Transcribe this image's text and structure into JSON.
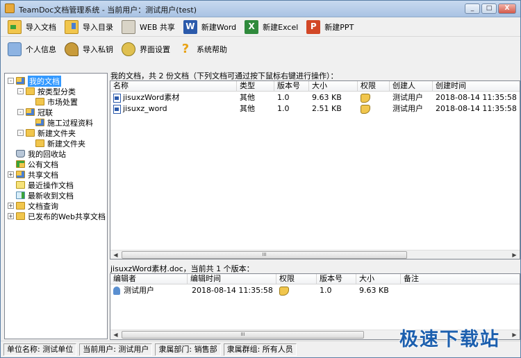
{
  "window": {
    "title": "TeamDoc文档管理系统 - 当前用户：测试用户(test)",
    "buttons": [
      "_",
      "□",
      "X"
    ]
  },
  "toolbar_main": [
    {
      "label": "导入文档",
      "icon": "import-document-icon"
    },
    {
      "label": "导入目录",
      "icon": "import-folder-icon"
    },
    {
      "label": "WEB 共享",
      "icon": "web-share-icon"
    },
    {
      "label": "新建Word",
      "icon": "word-icon",
      "glyph": "W"
    },
    {
      "label": "新建Excel",
      "icon": "excel-icon",
      "glyph": "X"
    },
    {
      "label": "新建PPT",
      "icon": "ppt-icon",
      "glyph": "P"
    }
  ],
  "toolbar_settings": [
    {
      "label": "个人信息",
      "icon": "user-info-icon"
    },
    {
      "label": "导入私钥",
      "icon": "key-icon"
    },
    {
      "label": "界面设置",
      "icon": "gear-icon"
    },
    {
      "label": "系统帮助",
      "icon": "help-icon",
      "glyph": "?"
    }
  ],
  "tree": {
    "nodes": [
      {
        "label": "我的文档",
        "level": 0,
        "expander": "-",
        "icon": "t-folder-share",
        "selected": true
      },
      {
        "label": "按类型分类",
        "level": 1,
        "expander": "-",
        "icon": "t-folder"
      },
      {
        "label": "市场处置",
        "level": 2,
        "expander": "",
        "icon": "t-folder"
      },
      {
        "label": "冠联",
        "level": 1,
        "expander": "-",
        "icon": "t-folder-share"
      },
      {
        "label": "施工过程资料",
        "level": 2,
        "expander": "",
        "icon": "t-folder-share"
      },
      {
        "label": "新建文件夹",
        "level": 1,
        "expander": "-",
        "icon": "t-folder"
      },
      {
        "label": "新建文件夹",
        "level": 2,
        "expander": "",
        "icon": "t-folder"
      },
      {
        "label": "我的回收站",
        "level": 0,
        "expander": "",
        "icon": "t-recycle"
      },
      {
        "label": "公有文档",
        "level": 0,
        "expander": "",
        "icon": "t-public"
      },
      {
        "label": "共享文档",
        "level": 0,
        "expander": "+",
        "icon": "t-folder-share"
      },
      {
        "label": "最近操作文档",
        "level": 0,
        "expander": "",
        "icon": "t-recent"
      },
      {
        "label": "最新收到文档",
        "level": 0,
        "expander": "",
        "icon": "t-new"
      },
      {
        "label": "文档查询",
        "level": 0,
        "expander": "+",
        "icon": "t-folder"
      },
      {
        "label": "已发布的Web共享文档",
        "level": 0,
        "expander": "+",
        "icon": "t-folder"
      }
    ]
  },
  "documents": {
    "header": "我的文档，共 2 份文档（下列文档可通过按下鼠标右键进行操作）：",
    "columns": [
      "名称",
      "类型",
      "版本号",
      "大小",
      "权限",
      "创建人",
      "创建时间"
    ],
    "rows": [
      {
        "name": "jisuxzWord素材",
        "type": "其他",
        "version": "1.0",
        "size": "9.63 KB",
        "creator": "测试用户",
        "created": "2018-08-14 11:35:58"
      },
      {
        "name": "jisuxz_word",
        "type": "其他",
        "version": "1.0",
        "size": "2.51 KB",
        "creator": "测试用户",
        "created": "2018-08-14 11:35:58"
      }
    ],
    "scroll_arrows": [
      "◀",
      "▶"
    ],
    "scroll_thumb_grip": "III"
  },
  "versions": {
    "header": "jisuxzWord素材.doc，当前共 1 个版本：",
    "columns": [
      "编辑者",
      "编辑时间",
      "权限",
      "版本号",
      "大小",
      "备注"
    ],
    "rows": [
      {
        "editor": "测试用户",
        "time": "2018-08-14 11:35:58",
        "version": "1.0",
        "size": "9.63 KB",
        "note": ""
      }
    ],
    "scroll_arrows": [
      "◀",
      "▶"
    ],
    "scroll_thumb_grip": "III"
  },
  "status": {
    "unit": "单位名称: 测试单位",
    "user": "当前用户: 测试用户",
    "dept": "隶属部门: 销售部",
    "group": "隶属群组: 所有人员"
  },
  "watermark": "极速下载站",
  "colors": {
    "selection": "#3399ff",
    "watermark": "#1c5fae",
    "title_gradient_top": "#c8daf0",
    "title_gradient_bottom": "#a9c3e3"
  }
}
